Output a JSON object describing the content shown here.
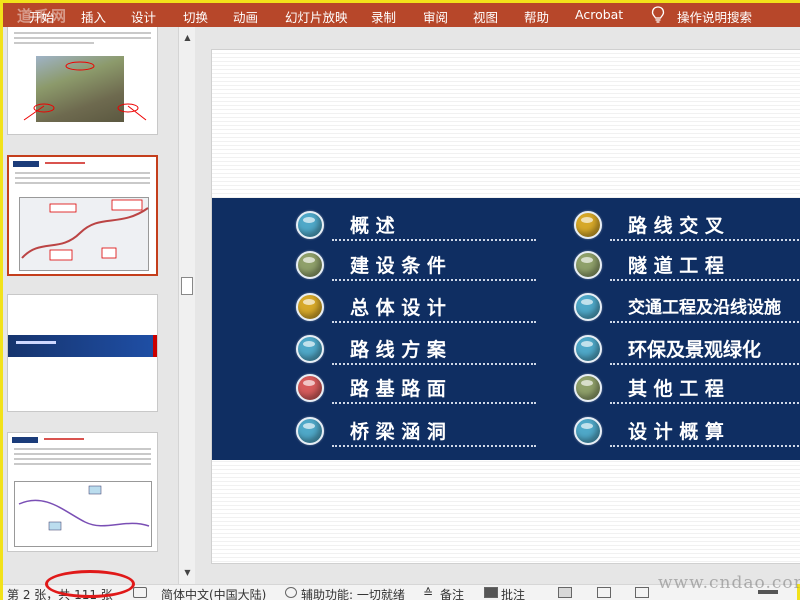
{
  "ribbon": {
    "logo": "道禾网",
    "tabs": [
      "开始",
      "插入",
      "设计",
      "切换",
      "动画",
      "幻灯片放映",
      "录制",
      "审阅",
      "视图",
      "帮助",
      "Acrobat"
    ],
    "search_label": "操作说明搜索"
  },
  "slide": {
    "left_items": [
      {
        "label": "概 述",
        "color": "#4fa8c8"
      },
      {
        "label": "建 设 条 件",
        "color": "#8fa06a"
      },
      {
        "label": "总 体 设 计",
        "color": "#d6a829"
      },
      {
        "label": "路 线 方 案",
        "color": "#4fa8c8"
      },
      {
        "label": "路 基 路 面",
        "color": "#d65b5b"
      },
      {
        "label": "桥 梁 涵 洞",
        "color": "#4fa8c8"
      }
    ],
    "right_items": [
      {
        "label": "路 线 交 叉",
        "color": "#d6a829"
      },
      {
        "label": "隧 道 工 程",
        "color": "#8fa06a"
      },
      {
        "label": "交通工程及沿线设施",
        "color": "#4fa8c8"
      },
      {
        "label": "环保及景观绿化",
        "color": "#4fa8c8"
      },
      {
        "label": "其 他 工 程",
        "color": "#8fa06a"
      },
      {
        "label": "设 计 概 算",
        "color": "#4fa8c8"
      }
    ],
    "navy_color": "#0f2e62"
  },
  "status": {
    "slide_counter": "第 2 张，共 111 张",
    "language": "简体中文(中国大陆)",
    "accessibility": "辅助功能: 一切就绪",
    "notes": "备注",
    "comments": "批注"
  },
  "watermark": "www.cndao.com"
}
